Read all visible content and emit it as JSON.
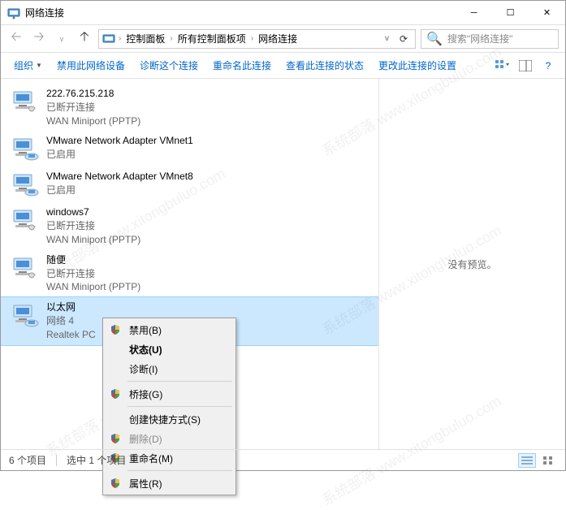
{
  "window": {
    "title": "网络连接",
    "search_placeholder": "搜索\"网络连接\""
  },
  "breadcrumb": {
    "items": [
      "控制面板",
      "所有控制面板项",
      "网络连接"
    ]
  },
  "toolbar": {
    "organize": "组织",
    "items": [
      "禁用此网络设备",
      "诊断这个连接",
      "重命名此连接",
      "查看此连接的状态",
      "更改此连接的设置"
    ]
  },
  "preview": {
    "no_preview": "没有预览。"
  },
  "connections": [
    {
      "name": "222.76.215.218",
      "status": "已断开连接",
      "device": "WAN Miniport (PPTP)",
      "type": "dialup"
    },
    {
      "name": "VMware Network Adapter VMnet1",
      "status": "已启用",
      "device": "",
      "type": "ethernet"
    },
    {
      "name": "VMware Network Adapter VMnet8",
      "status": "已启用",
      "device": "",
      "type": "ethernet"
    },
    {
      "name": "windows7",
      "status": "已断开连接",
      "device": "WAN Miniport (PPTP)",
      "type": "dialup"
    },
    {
      "name": "随便",
      "status": "已断开连接",
      "device": "WAN Miniport (PPTP)",
      "type": "dialup"
    },
    {
      "name": "以太网",
      "status": "网络 4",
      "device": "Realtek PC",
      "type": "ethernet",
      "selected": true
    }
  ],
  "context_menu": {
    "items": [
      {
        "label": "禁用(B)",
        "icon": "shield"
      },
      {
        "label": "状态(U)",
        "bold": true
      },
      {
        "label": "诊断(I)"
      },
      {
        "sep": true
      },
      {
        "label": "桥接(G)",
        "icon": "shield"
      },
      {
        "sep": true
      },
      {
        "label": "创建快捷方式(S)"
      },
      {
        "label": "删除(D)",
        "icon": "shield",
        "disabled": true
      },
      {
        "label": "重命名(M)",
        "icon": "shield"
      },
      {
        "sep": true
      },
      {
        "label": "属性(R)",
        "icon": "shield"
      }
    ]
  },
  "statusbar": {
    "count": "6 个项目",
    "selected": "选中 1 个项目"
  },
  "watermark": "系统部落 www.xitongbuluo.com"
}
